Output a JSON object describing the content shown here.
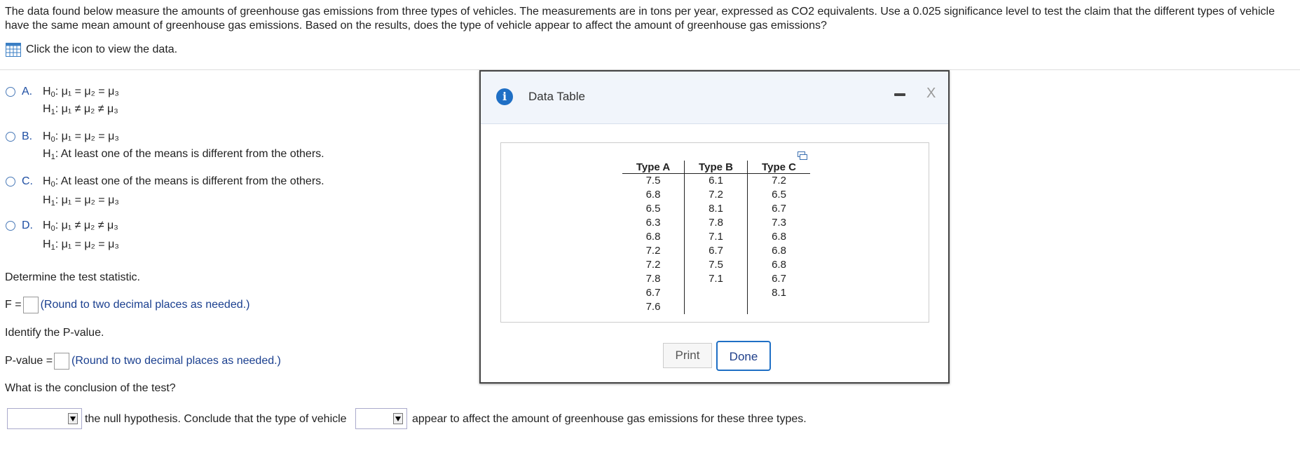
{
  "intro": "The data found below measure the amounts of greenhouse gas emissions from three types of vehicles. The measurements are in tons per year, expressed as CO2 equivalents. Use a 0.025 significance level to test the claim that the different types of vehicle have the same mean amount of greenhouse gas emissions. Based on the results, does the type of vehicle appear to affect the amount of greenhouse gas emissions?",
  "view_data_label": "Click the icon to view the data.",
  "options": [
    {
      "letter": "A.",
      "h0": "H",
      "h0_sub": "0",
      "h0_text": ": μ₁ = μ₂ = μ₃",
      "h1": "H",
      "h1_sub": "1",
      "h1_text": ": μ₁ ≠ μ₂ ≠ μ₃"
    },
    {
      "letter": "B.",
      "h0": "H",
      "h0_sub": "0",
      "h0_text": ": μ₁ = μ₂ = μ₃",
      "h1": "H",
      "h1_sub": "1",
      "h1_text": ": At least one of the means is different from the others."
    },
    {
      "letter": "C.",
      "h0": "H",
      "h0_sub": "0",
      "h0_text": ": At least one of the means is different from the others.",
      "h1": "H",
      "h1_sub": "1",
      "h1_text": ": μ₁ = μ₂ = μ₃"
    },
    {
      "letter": "D.",
      "h0": "H",
      "h0_sub": "0",
      "h0_text": ": μ₁ ≠ μ₂ ≠ μ₃",
      "h1": "H",
      "h1_sub": "1",
      "h1_text": ": μ₁ = μ₂ = μ₃"
    }
  ],
  "test_stat_prompt": "Determine the test statistic.",
  "f_label": "F =",
  "round_hint": "(Round to two decimal places as needed.)",
  "pvalue_prompt": "Identify the P-value.",
  "pvalue_label": "P-value =",
  "conclusion_prompt": "What is the conclusion of the test?",
  "conclusion_mid": "the null hypothesis. Conclude that the type of vehicle",
  "conclusion_end": "appear to affect the amount of greenhouse gas emissions for these three types.",
  "dialog": {
    "title": "Data Table",
    "info_icon": "i",
    "close": "X",
    "print": "Print",
    "done": "Done",
    "columns": [
      "Type A",
      "Type B",
      "Type C"
    ],
    "rows": [
      [
        "7.5",
        "6.1",
        "7.2"
      ],
      [
        "6.8",
        "7.2",
        "6.5"
      ],
      [
        "6.5",
        "8.1",
        "6.7"
      ],
      [
        "6.3",
        "7.8",
        "7.3"
      ],
      [
        "6.8",
        "7.1",
        "6.8"
      ],
      [
        "7.2",
        "6.7",
        "6.8"
      ],
      [
        "7.2",
        "7.5",
        "6.8"
      ],
      [
        "7.8",
        "7.1",
        "6.7"
      ],
      [
        "6.7",
        "",
        "8.1"
      ],
      [
        "7.6",
        "",
        ""
      ]
    ]
  }
}
